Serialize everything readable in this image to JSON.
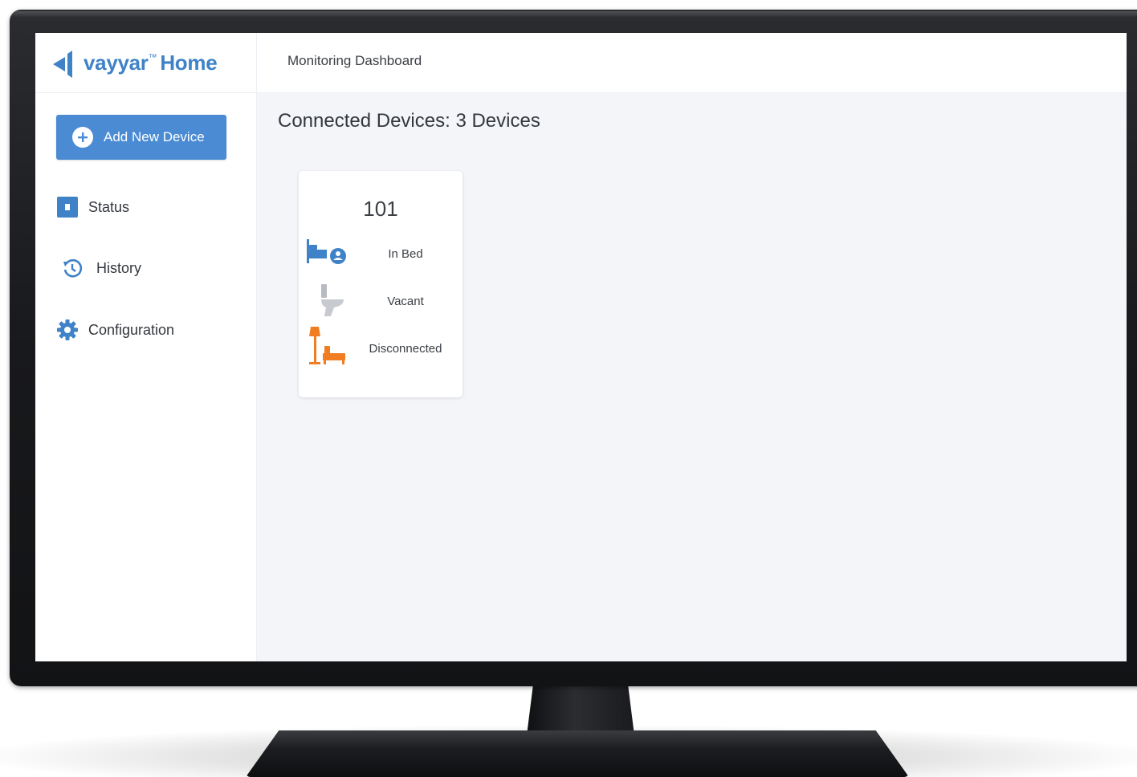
{
  "app": {
    "brand": "vayyar",
    "trademark": "™",
    "product": "Home",
    "brand_color": "#3f82c7"
  },
  "header": {
    "title": "Monitoring Dashboard"
  },
  "sidebar": {
    "add_button": {
      "label": "Add New Device",
      "icon": "plus-circle-icon",
      "color": "#4a8bd4"
    },
    "items": [
      {
        "label": "Status",
        "icon": "status-square-icon"
      },
      {
        "label": "History",
        "icon": "history-icon"
      },
      {
        "label": "Configuration",
        "icon": "gear-icon"
      }
    ]
  },
  "main": {
    "title": "Connected Devices: 3 Devices",
    "devices": [
      {
        "room": "101",
        "statuses": [
          {
            "label": "In Bed",
            "icon": "bed-person-icon",
            "color": "#3f82c7"
          },
          {
            "label": "Vacant",
            "icon": "toilet-icon",
            "color": "#b8bcc2"
          },
          {
            "label": "Disconnected",
            "icon": "lamp-chair-icon",
            "color": "#f07d22"
          }
        ]
      }
    ]
  }
}
